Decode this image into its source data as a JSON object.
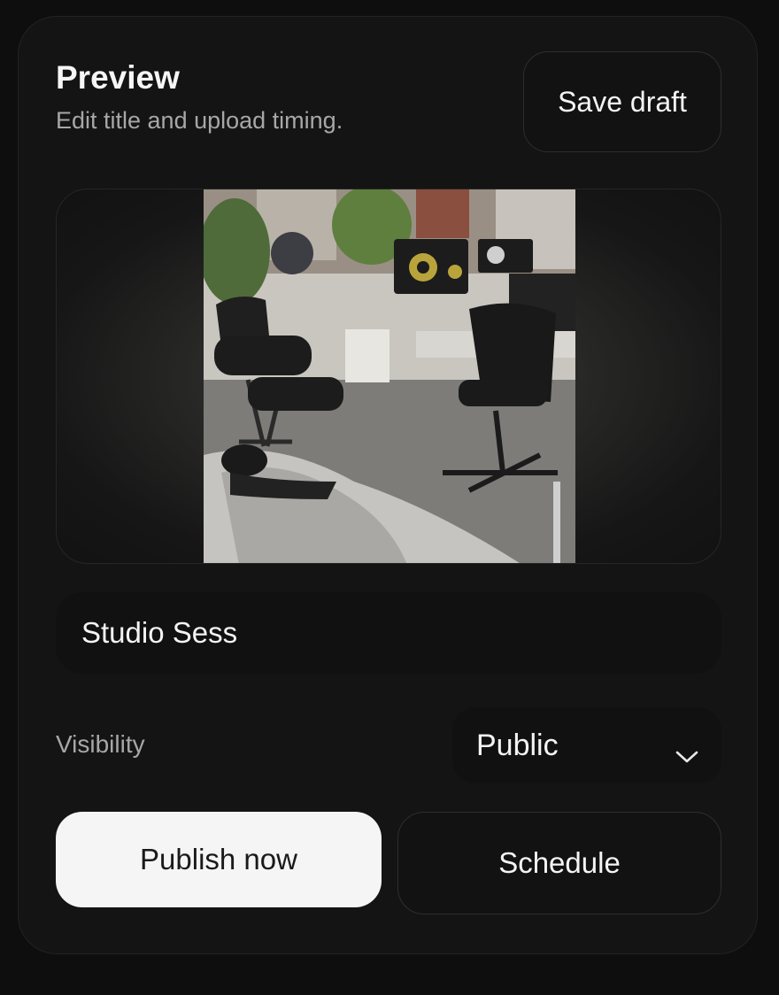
{
  "header": {
    "title": "Preview",
    "subtitle": "Edit title and upload timing.",
    "save_draft_label": "Save draft"
  },
  "media": {
    "icon": "photo-studio-image"
  },
  "title_field": {
    "value": "Studio Sess"
  },
  "visibility": {
    "label": "Visibility",
    "selected": "Public"
  },
  "actions": {
    "publish_label": "Publish now",
    "schedule_label": "Schedule"
  },
  "colors": {
    "background": "#0e0e0f",
    "card": "#141414",
    "primary_button": "#f5f5f5"
  }
}
